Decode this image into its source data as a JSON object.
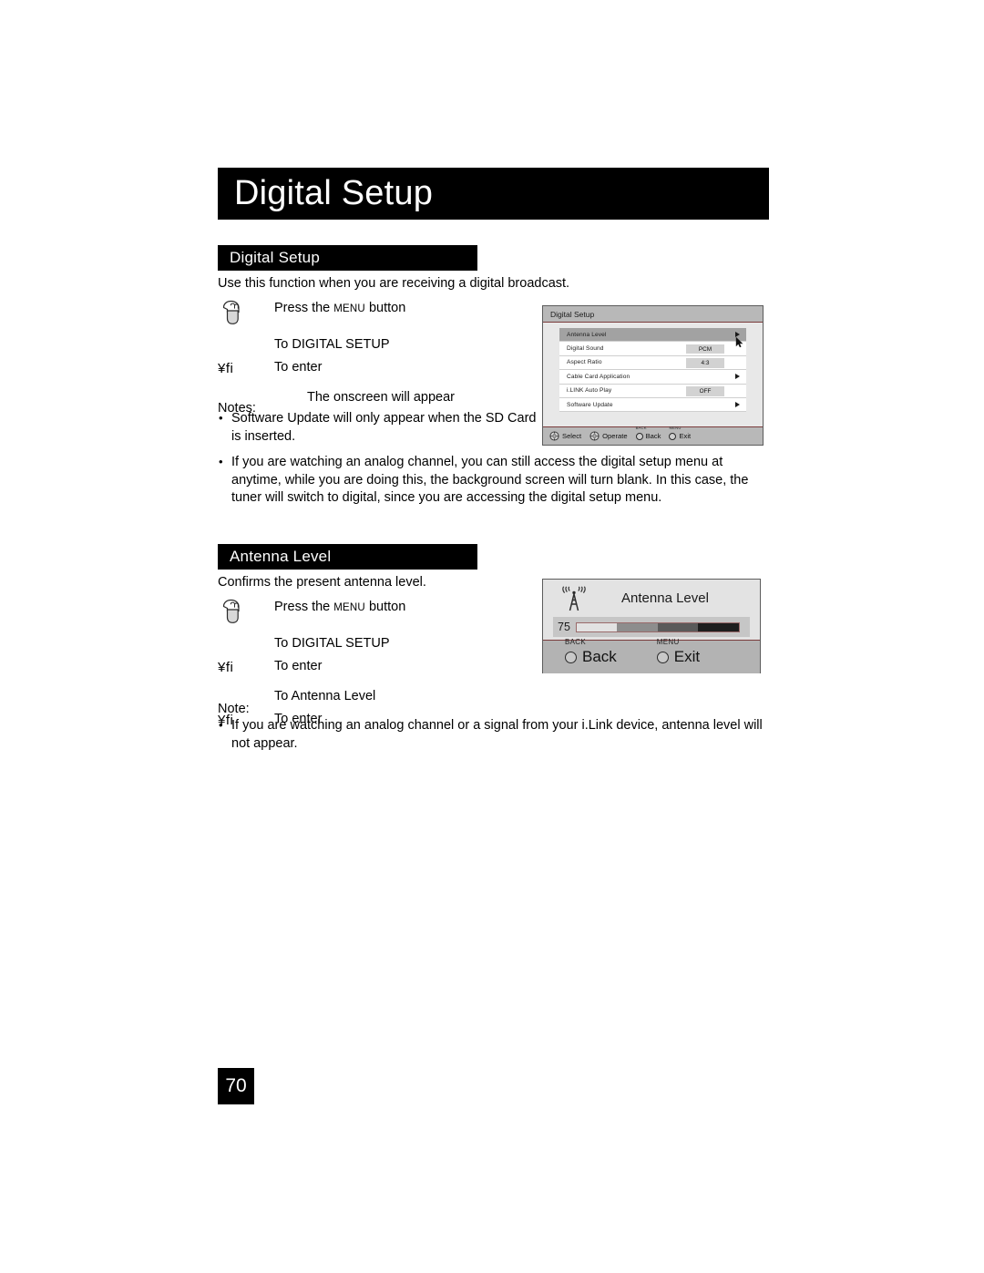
{
  "chapter": {
    "title": "Digital Setup"
  },
  "sections": [
    {
      "heading": "Digital Setup",
      "intro": "Use this function when you are receiving a digital broadcast.",
      "steps": [
        {
          "key": "press-icon",
          "text": "Press the ",
          "smallcaps": "MENU",
          "text_after": " button"
        },
        {
          "key": "",
          "text": "To DIGITAL SETUP"
        },
        {
          "key": "arrow-keys",
          "text": "To enter"
        },
        {
          "key": "",
          "text": "The onscreen will appear"
        }
      ],
      "notes_label": "Notes:",
      "notes": [
        "Software Update will only appear when the SD Card is inserted.",
        "If you are watching an analog channel, you can still access the digital setup menu at anytime, while you are doing this, the background screen will turn blank.  In this case, the tuner will switch to digital, since you are accessing the digital setup menu."
      ]
    },
    {
      "heading": "Antenna Level",
      "intro": "Confirms the present antenna level.",
      "steps": [
        {
          "key": "press-icon",
          "text": "Press the ",
          "smallcaps": "MENU",
          "text_after": " button"
        },
        {
          "key": "",
          "text": "To DIGITAL SETUP"
        },
        {
          "key": "arrow-keys",
          "text": "To enter"
        },
        {
          "key": "",
          "text": "To Antenna Level"
        },
        {
          "key": "arrow-keys",
          "text": "To enter"
        }
      ],
      "notes_label": "Note:",
      "notes": [
        "If you are watching an analog channel or a signal from your i.Link device, antenna level will not appear."
      ]
    }
  ],
  "arrow_key_glyph": "¥fi",
  "osd_menu": {
    "title": "Digital Setup",
    "rows": [
      {
        "label": "Antenna Level",
        "value": "",
        "arrow": true,
        "highlight": true
      },
      {
        "label": "Digital Sound",
        "value": "PCM",
        "arrow": false,
        "highlight": false
      },
      {
        "label": "Aspect Ratio",
        "value": "4:3",
        "arrow": false,
        "highlight": false
      },
      {
        "label": "Cable Card Application",
        "value": "",
        "arrow": true,
        "highlight": false
      },
      {
        "label": "i.LINK Auto Play",
        "value": "OFF",
        "arrow": false,
        "highlight": false
      },
      {
        "label": "Software Update",
        "value": "",
        "arrow": true,
        "highlight": false
      }
    ],
    "footer": [
      {
        "sup": "",
        "label": "Select",
        "icon": "dpad-ring-icon"
      },
      {
        "sup": "",
        "label": "Operate",
        "icon": "dpad-ring-icon"
      },
      {
        "sup": "BACK",
        "label": "Back",
        "icon": "circle-button-icon"
      },
      {
        "sup": "MENU",
        "label": "Exit",
        "icon": "circle-button-icon"
      }
    ]
  },
  "osd_antenna": {
    "title": "Antenna Level",
    "level_value": "75",
    "bar_segments": [
      "#e2e2e2",
      "#8d8d8d",
      "#5a5a5a",
      "#1e1e1e"
    ],
    "footer": [
      {
        "sup": "BACK",
        "label": "Back"
      },
      {
        "sup": "MENU",
        "label": "Exit"
      }
    ]
  },
  "page_number": "70"
}
